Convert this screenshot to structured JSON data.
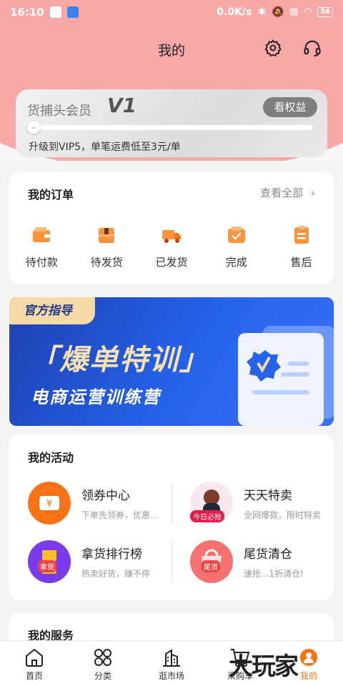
{
  "status_bar": {
    "time": "16:10",
    "speed": "0.0K/s",
    "battery": "56"
  },
  "header": {
    "title": "我的"
  },
  "member": {
    "name": "货捕头会员",
    "level": "V1",
    "benefits_button": "看权益",
    "upgrade_text": "升级到VIP5，单笔运费低至3元/单"
  },
  "orders": {
    "title": "我的订单",
    "view_all": "查看全部",
    "items": [
      {
        "label": "待付款",
        "icon": "wallet-icon"
      },
      {
        "label": "待发货",
        "icon": "box-icon"
      },
      {
        "label": "已发货",
        "icon": "truck-icon"
      },
      {
        "label": "完成",
        "icon": "check-box-icon"
      },
      {
        "label": "售后",
        "icon": "clipboard-icon"
      }
    ]
  },
  "banner": {
    "tag": "官方指导",
    "title": "「爆单特训」",
    "subtitle": "电商运营训练营"
  },
  "activities": {
    "title": "我的活动",
    "items": [
      {
        "name": "领券中心",
        "desc": "下单先领券，优惠…"
      },
      {
        "name": "天天特卖",
        "desc": "全网爆款，限时特卖",
        "badge": "今日必抢"
      },
      {
        "name": "拿货排行榜",
        "desc": "热卖好货，赚不停",
        "badge": "拿货"
      },
      {
        "name": "尾货清仓",
        "desc": "速抢...1折清仓!",
        "badge": "尾货"
      }
    ]
  },
  "services": {
    "title": "我的服务"
  },
  "tabbar": [
    {
      "label": "首页",
      "icon": "home-icon"
    },
    {
      "label": "分类",
      "icon": "grid-icon"
    },
    {
      "label": "逛市场",
      "icon": "building-icon"
    },
    {
      "label": "采购车",
      "icon": "cart-icon"
    },
    {
      "label": "我的",
      "icon": "profile-icon"
    }
  ],
  "watermark": "大玩家",
  "colors": {
    "header_pink": "#f9a8a8",
    "accent_orange": "#f97316",
    "banner_blue": "#1e40af"
  }
}
